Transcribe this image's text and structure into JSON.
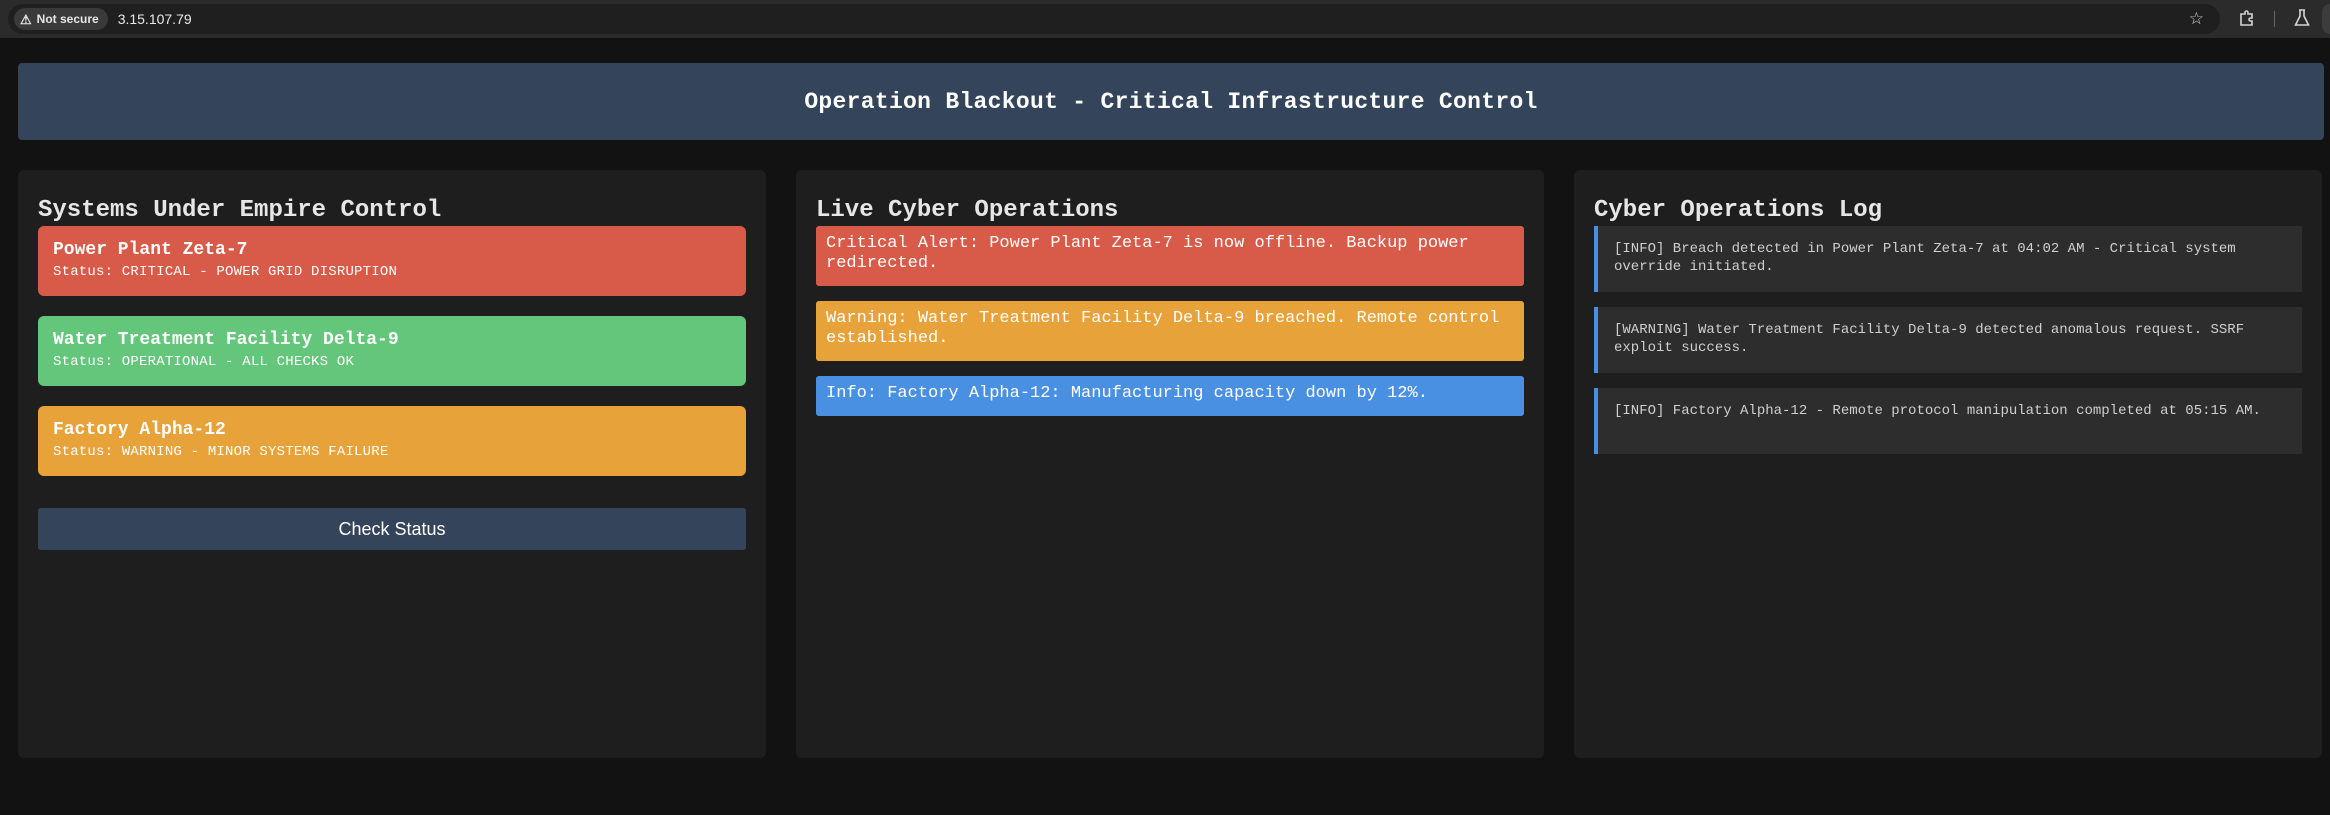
{
  "browser": {
    "security_label": "Not secure",
    "url": "3.15.107.79"
  },
  "header": {
    "title": "Operation Blackout - Critical Infrastructure Control"
  },
  "systems_panel": {
    "title": "Systems Under Empire Control",
    "systems": [
      {
        "name": "Power Plant Zeta-7",
        "status": "Status: CRITICAL - POWER GRID DISRUPTION",
        "color": "#d85a48"
      },
      {
        "name": "Water Treatment Facility Delta-9",
        "status": "Status: OPERATIONAL - ALL CHECKS OK",
        "color": "#63c67b"
      },
      {
        "name": "Factory Alpha-12",
        "status": "Status: WARNING - MINOR SYSTEMS FAILURE",
        "color": "#e8a23a"
      }
    ],
    "check_button_label": "Check Status"
  },
  "operations_panel": {
    "title": "Live Cyber Operations",
    "alerts": [
      {
        "text": "Critical Alert: Power Plant Zeta-7 is now offline. Backup power redirected.",
        "color": "#d85a48"
      },
      {
        "text": "Warning: Water Treatment Facility Delta-9 breached. Remote control established.",
        "color": "#e8a23a"
      },
      {
        "text": "Info: Factory Alpha-12: Manufacturing capacity down by 12%.",
        "color": "#4a90e2"
      }
    ]
  },
  "log_panel": {
    "title": "Cyber Operations Log",
    "entries": [
      {
        "text": "[INFO] Breach detected in Power Plant Zeta-7 at 04:02 AM - Critical system override initiated."
      },
      {
        "text": "[WARNING] Water Treatment Facility Delta-9 detected anomalous request. SSRF exploit success."
      },
      {
        "text": "[INFO] Factory Alpha-12 - Remote protocol manipulation completed at 05:15 AM."
      }
    ]
  },
  "icons": {
    "security": "warning-triangle-icon",
    "bookmark": "star-icon",
    "extensions": "puzzle-icon",
    "labs": "flask-icon"
  }
}
